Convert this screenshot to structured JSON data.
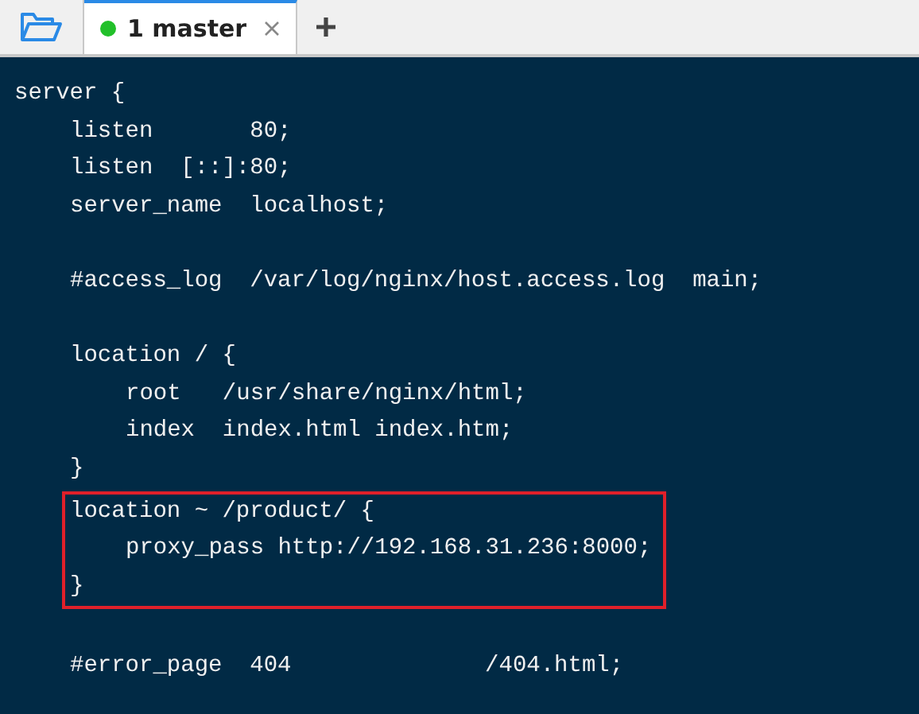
{
  "tabs": [
    {
      "label": "1 master",
      "selected": true,
      "connected": true
    }
  ],
  "code": [
    {
      "kind": "line",
      "text": "server {",
      "children": [
        {
          "kind": "line",
          "text": "listen       80;"
        },
        {
          "kind": "line",
          "text": "listen  [::]:80;"
        },
        {
          "kind": "line",
          "text": "server_name  localhost;"
        },
        {
          "kind": "line",
          "text": "#access_log  /var/log/nginx/host.access.log  main;",
          "gap_before": true
        },
        {
          "kind": "line",
          "text": "location / {",
          "gap_before": true,
          "children": [
            {
              "kind": "line",
              "text": "root   /usr/share/nginx/html;"
            },
            {
              "kind": "line",
              "text": "index  index.html index.htm;"
            }
          ]
        },
        {
          "kind": "line",
          "text": "}"
        },
        {
          "kind": "highlight",
          "children": [
            {
              "kind": "line",
              "text": "location ~ /product/ {",
              "children": [
                {
                  "kind": "line",
                  "text": "proxy_pass http://192.168.31.236:8000;"
                }
              ]
            },
            {
              "kind": "line",
              "text": "}"
            }
          ]
        },
        {
          "kind": "line",
          "text": "#error_page  404              /404.html;",
          "gap_before": true
        }
      ]
    }
  ]
}
